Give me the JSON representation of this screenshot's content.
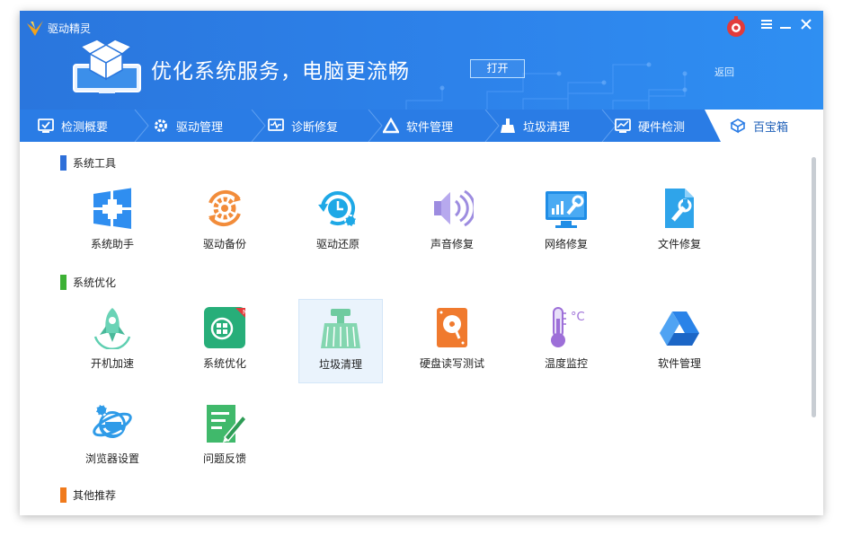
{
  "app": {
    "title": "驱动精灵"
  },
  "banner": {
    "slogan": "优化系统服务，电脑更流畅",
    "open_button": "打开",
    "back_link": "返回"
  },
  "tabs": [
    {
      "label": "检测概要",
      "icon": "monitor-check-icon"
    },
    {
      "label": "驱动管理",
      "icon": "gear-icon"
    },
    {
      "label": "诊断修复",
      "icon": "diagnose-icon"
    },
    {
      "label": "软件管理",
      "icon": "triangle-icon"
    },
    {
      "label": "垃圾清理",
      "icon": "broom-icon"
    },
    {
      "label": "硬件检测",
      "icon": "hardware-chart-icon"
    },
    {
      "label": "百宝箱",
      "icon": "toolbox-icon",
      "active": true
    }
  ],
  "sections": [
    {
      "title": "系统工具",
      "color": "#2e6fd9",
      "items": [
        {
          "label": "系统助手",
          "icon": "windows-plus-icon"
        },
        {
          "label": "驱动备份",
          "icon": "gear-backup-icon"
        },
        {
          "label": "驱动还原",
          "icon": "clock-restore-icon"
        },
        {
          "label": "声音修复",
          "icon": "speaker-icon"
        },
        {
          "label": "网络修复",
          "icon": "monitor-wrench-icon"
        },
        {
          "label": "文件修复",
          "icon": "file-wrench-icon"
        }
      ]
    },
    {
      "title": "系统优化",
      "color": "#3db135",
      "items": [
        {
          "label": "开机加速",
          "icon": "rocket-icon"
        },
        {
          "label": "系统优化",
          "icon": "system-optimize-icon",
          "badge": "N"
        },
        {
          "label": "垃圾清理",
          "icon": "broom-icon",
          "highlighted": true
        },
        {
          "label": "硬盘读写测试",
          "icon": "hard-disk-icon"
        },
        {
          "label": "温度监控",
          "icon": "thermometer-icon",
          "unit": "°C"
        },
        {
          "label": "软件管理",
          "icon": "software-triangle-icon"
        },
        {
          "label": "浏览器设置",
          "icon": "browser-e-icon"
        },
        {
          "label": "问题反馈",
          "icon": "feedback-note-icon"
        }
      ]
    },
    {
      "title": "其他推荐",
      "color": "#f07a1c",
      "items": []
    }
  ]
}
